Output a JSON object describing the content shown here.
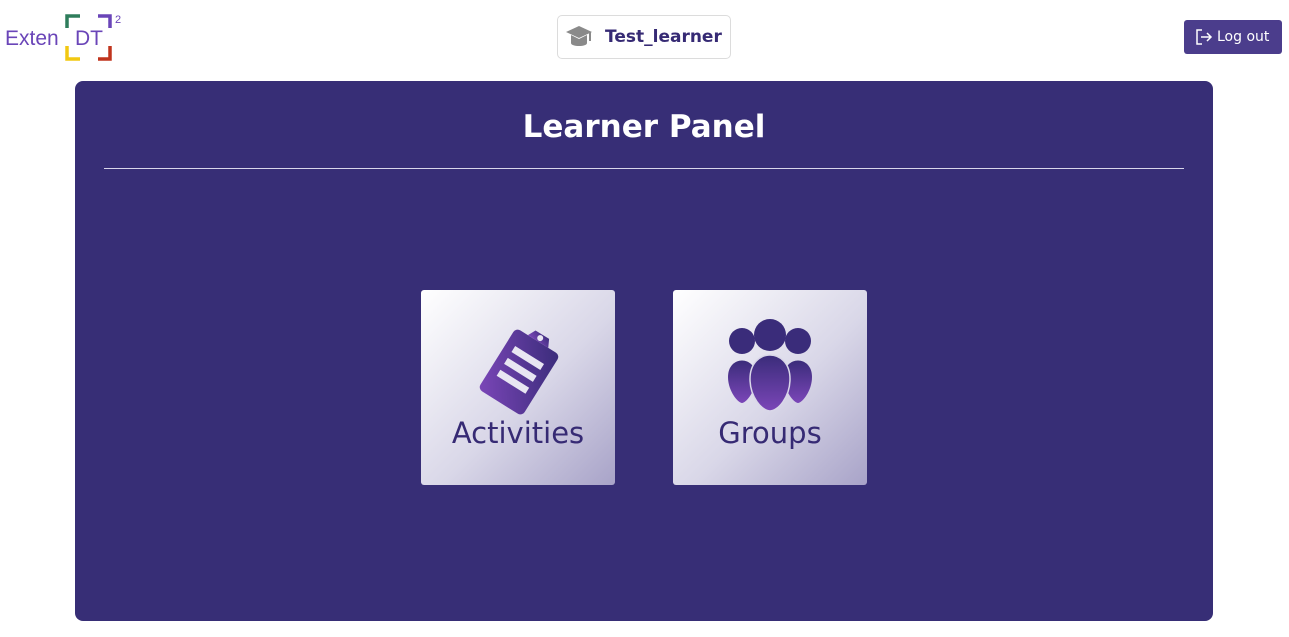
{
  "header": {
    "logo": {
      "text_main": "Exten",
      "text_bracketed": "DT",
      "superscript": "2",
      "colors": {
        "text": "#6a45b8",
        "green": "#2e7d5b",
        "purple": "#6a45b8",
        "yellow": "#f2c811",
        "red": "#c0341d"
      }
    },
    "user": {
      "name": "Test_learner",
      "icon": "graduation-cap-icon"
    },
    "logout": {
      "label": "Log out",
      "icon": "logout-icon"
    }
  },
  "panel": {
    "title": "Learner Panel",
    "tiles": [
      {
        "label": "Activities",
        "icon": "clipboard-icon"
      },
      {
        "label": "Groups",
        "icon": "group-icon"
      }
    ]
  },
  "colors": {
    "panel_bg": "#372e76",
    "accent": "#4b3d8c",
    "tile_text": "#362a74"
  }
}
